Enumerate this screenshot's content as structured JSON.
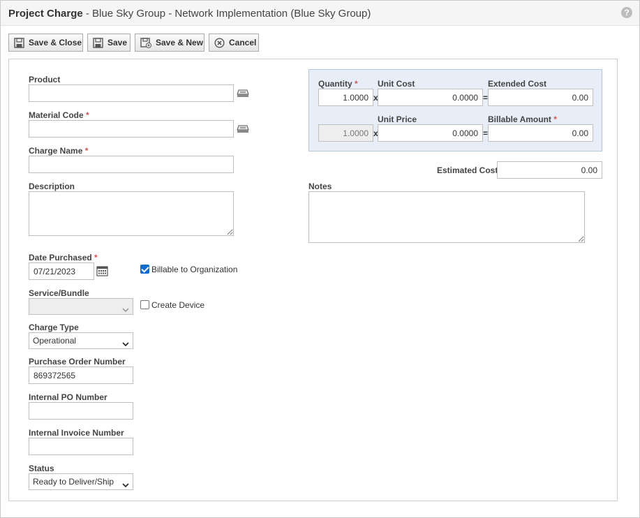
{
  "title": {
    "bold": "Project Charge",
    "rest": " - Blue Sky Group - Network Implementation (Blue Sky Group)"
  },
  "help_icon": "?",
  "toolbar": {
    "save_close": "Save & Close",
    "save": "Save",
    "save_new": "Save & New",
    "cancel": "Cancel"
  },
  "form": {
    "product_label": "Product",
    "product_value": "",
    "material_code_label": "Material Code",
    "material_code_value": "",
    "charge_name_label": "Charge Name",
    "charge_name_value": "",
    "description_label": "Description",
    "description_value": "",
    "date_purchased_label": "Date Purchased",
    "date_purchased_value": "07/21/2023",
    "billable_label": "Billable to Organization",
    "billable_checked": true,
    "service_bundle_label": "Service/Bundle",
    "service_bundle_value": "",
    "create_device_label": "Create Device",
    "create_device_checked": false,
    "charge_type_label": "Charge Type",
    "charge_type_value": "Operational",
    "po_number_label": "Purchase Order Number",
    "po_number_value": "869372565",
    "internal_po_label": "Internal PO Number",
    "internal_po_value": "",
    "internal_invoice_label": "Internal Invoice Number",
    "internal_invoice_value": "",
    "status_label": "Status",
    "status_value": "Ready to Deliver/Ship",
    "required_mark": "*"
  },
  "costs": {
    "quantity_label": "Quantity",
    "unit_cost_label": "Unit Cost",
    "extended_cost_label": "Extended Cost",
    "unit_price_label": "Unit Price",
    "billable_amount_label": "Billable Amount",
    "quantity_value": "1.0000",
    "unit_cost_value": "0.0000",
    "extended_cost_value": "0.00",
    "quantity2_value": "1.0000",
    "unit_price_value": "0.0000",
    "billable_amount_value": "0.00",
    "times": "x",
    "equals": "=",
    "estimated_cost_label": "Estimated Cost",
    "estimated_cost_value": "0.00",
    "notes_label": "Notes",
    "notes_value": ""
  },
  "colors": {
    "required": "#d9534f",
    "checkbox": "#0f6ecd",
    "cost_panel": "#e8eef7"
  }
}
